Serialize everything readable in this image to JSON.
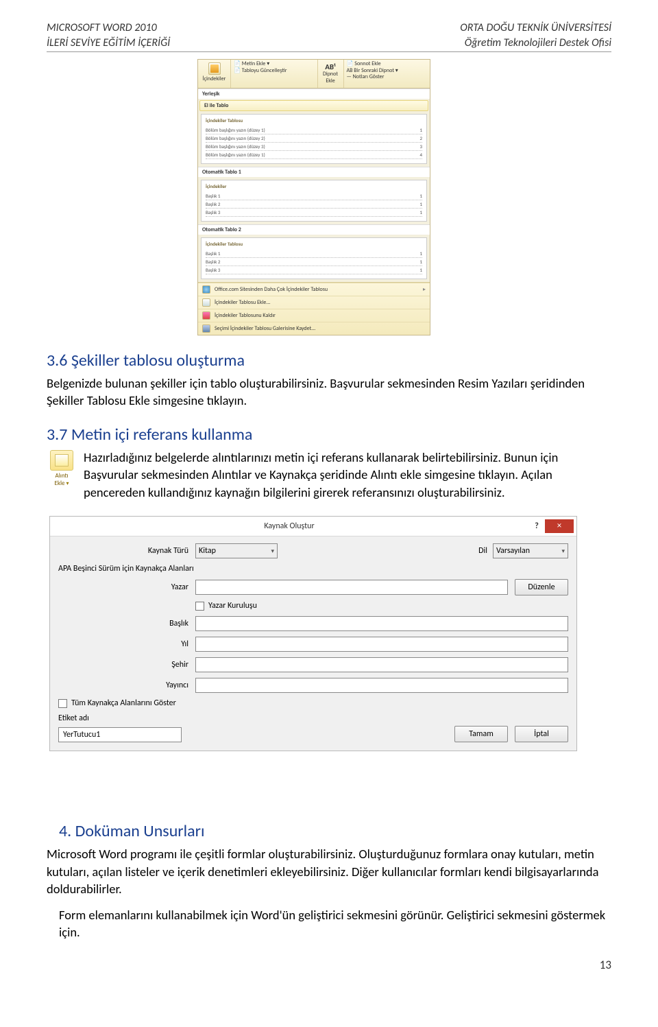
{
  "header": {
    "left_line1": "MICROSOFT WORD 2010",
    "left_line2": "İLERİ SEVİYE EĞİTİM İÇERİĞİ",
    "right_line1": "ORTA DOĞU TEKNİK ÜNİVERSİTESİ",
    "right_line2": "Öğretim Teknolojileri Destek Ofisi"
  },
  "toc_dropdown": {
    "ribbon": {
      "group1_button": "İçindekiler",
      "metin_ekle": "Metin Ekle",
      "tabloyu_guncellestir": "Tabloyu Güncelleştir",
      "ab_label": "AB¹",
      "dipnot_ekle": "Dipnot Ekle",
      "sonnot_ekle": "Sonnot Ekle",
      "bir_sonraki_dipnot": "Bir Sonraki Dipnot",
      "notlari_goster": "Notları Göster"
    },
    "sections": {
      "yerlesik": "Yerleşik",
      "el_ile_tablo": "El ile Tablo",
      "otomatik1": "Otomatik Tablo 1",
      "otomatik2": "Otomatik Tablo 2"
    },
    "preview1": {
      "title": "İçindekiler Tablosu",
      "lines": [
        [
          "Bölüm başlığını yazın (düzey 1)",
          "1"
        ],
        [
          "Bölüm başlığını yazın (düzey 2)",
          "2"
        ],
        [
          "Bölüm başlığını yazın (düzey 3)",
          "3"
        ],
        [
          "Bölüm başlığını yazın (düzey 1)",
          "4"
        ]
      ]
    },
    "preview2": {
      "title": "İçindekiler",
      "lines": [
        [
          "Başlık 1",
          "1"
        ],
        [
          "Başlık 2",
          "1"
        ],
        [
          "Başlık 3",
          "1"
        ]
      ]
    },
    "preview3": {
      "title": "İçindekiler Tablosu",
      "lines": [
        [
          "Başlık 1",
          "1"
        ],
        [
          "Başlık 2",
          "1"
        ],
        [
          "Başlık 3",
          "1"
        ]
      ]
    },
    "footer": {
      "office_com": "Office.com Sitesinden Daha Çok İçindekiler Tablosu",
      "ekle": "İçindekiler Tablosu Ekle...",
      "kaldir": "İçindekiler Tablosunu Kaldır",
      "kaydet": "Seçimi İçindekiler Tablosu Galerisine Kaydet..."
    }
  },
  "h36": "3.6 Şekiller tablosu oluşturma",
  "p36": "Belgenizde bulunan şekiller için tablo oluşturabilirsiniz. Başvurular sekmesinden Resim Yazıları şeridinden Şekiller Tablosu Ekle simgesine tıklayın.",
  "h37": "3.7 Metin içi referans kullanma",
  "p37": "Hazırladığınız belgelerde alıntılarınızı metin içi referans kullanarak belirtebilirsiniz. Bunun için Başvurular sekmesinden Alıntılar ve Kaynakça şeridinde Alıntı ekle simgesine tıklayın. Açılan pencereden kullandığınız kaynağın bilgilerini girerek referansınızı oluşturabilirsiniz.",
  "alinti_icon": {
    "label1": "Alıntı",
    "label2": "Ekle"
  },
  "dialog": {
    "title": "Kaynak Oluştur",
    "help": "?",
    "close": "×",
    "labels": {
      "kaynak_turu": "Kaynak Türü",
      "dil": "Dil",
      "apa": "APA Beşinci Sürüm için Kaynakça Alanları",
      "yazar": "Yazar",
      "yazar_kurulusu": "Yazar Kuruluşu",
      "baslik": "Başlık",
      "yil": "Yıl",
      "sehir": "Şehir",
      "yayinci": "Yayıncı",
      "tum_alanlar": "Tüm Kaynakça Alanlarını Göster",
      "etiket_adi": "Etiket adı",
      "duzenle": "Düzenle",
      "tamam": "Tamam",
      "iptal": "İptal"
    },
    "values": {
      "kaynak_turu": "Kitap",
      "dil": "Varsayılan",
      "etiket": "YerTutucu1"
    }
  },
  "h4": "4.  Doküman Unsurları",
  "p4a": "Microsoft Word programı ile çeşitli formlar oluşturabilirsiniz. Oluşturduğunuz formlara onay kutuları, metin kutuları, açılan listeler ve içerik denetimleri ekleyebilirsiniz. Diğer kullanıcılar formları kendi bilgisayarlarında doldurabilirler.",
  "p4b": "Form elemanlarını kullanabilmek için Word'ün geliştirici sekmesini görünür. Geliştirici sekmesini göstermek için.",
  "page_number": "13"
}
